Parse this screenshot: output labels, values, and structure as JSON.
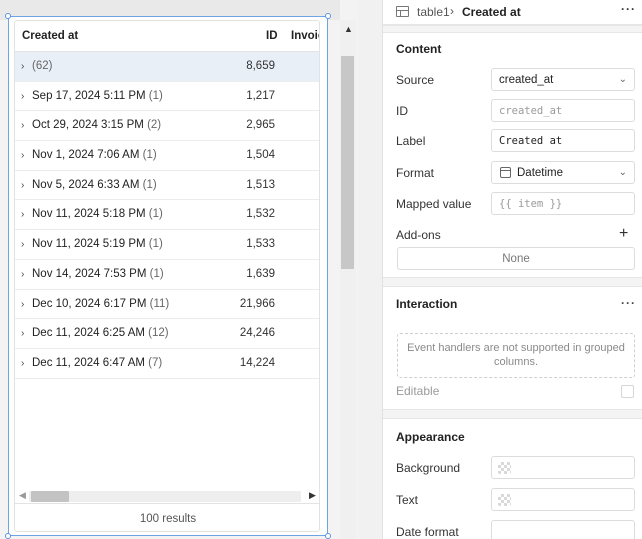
{
  "table": {
    "columns": {
      "created_at": "Created at",
      "id": "ID",
      "invoice": "Invoic"
    },
    "rows": [
      {
        "label": "",
        "count": "(62)",
        "id": "8,659"
      },
      {
        "label": "Sep 17, 2024 5:11 PM",
        "count": "(1)",
        "id": "1,217"
      },
      {
        "label": "Oct 29, 2024 3:15 PM",
        "count": "(2)",
        "id": "2,965"
      },
      {
        "label": "Nov 1, 2024 7:06 AM",
        "count": "(1)",
        "id": "1,504"
      },
      {
        "label": "Nov 5, 2024 6:33 AM",
        "count": "(1)",
        "id": "1,513"
      },
      {
        "label": "Nov 11, 2024 5:18 PM",
        "count": "(1)",
        "id": "1,532"
      },
      {
        "label": "Nov 11, 2024 5:19 PM",
        "count": "(1)",
        "id": "1,533"
      },
      {
        "label": "Nov 14, 2024 7:53 PM",
        "count": "(1)",
        "id": "1,639"
      },
      {
        "label": "Dec 10, 2024 6:17 PM",
        "count": "(11)",
        "id": "21,966"
      },
      {
        "label": "Dec 11, 2024 6:25 AM",
        "count": "(12)",
        "id": "24,246"
      },
      {
        "label": "Dec 11, 2024 6:47 AM",
        "count": "(7)",
        "id": "14,224"
      }
    ],
    "footer": "100 results",
    "chevron": "›"
  },
  "inspector": {
    "breadcrumb": {
      "parent": "table1",
      "separator": "›",
      "current": "Created at",
      "more": "···"
    },
    "content": {
      "title": "Content",
      "source_label": "Source",
      "source_value": "created_at",
      "id_label": "ID",
      "id_placeholder": "created_at",
      "label_label": "Label",
      "label_value": "Created at",
      "format_label": "Format",
      "format_value": "Datetime",
      "mapped_label": "Mapped value",
      "mapped_placeholder": "{{ item }}",
      "addons_label": "Add-ons",
      "addons_plus": "+",
      "addons_none": "None",
      "caret": "⌄"
    },
    "interaction": {
      "title": "Interaction",
      "more": "···",
      "notice": "Event handlers are not supported in grouped columns.",
      "editable_label": "Editable"
    },
    "appearance": {
      "title": "Appearance",
      "background_label": "Background",
      "text_label": "Text",
      "date_format_label": "Date format"
    }
  },
  "icons": {
    "breadcrumb": "table-icon",
    "format": "calendar-icon",
    "swatch": "transparent-swatch-icon"
  }
}
